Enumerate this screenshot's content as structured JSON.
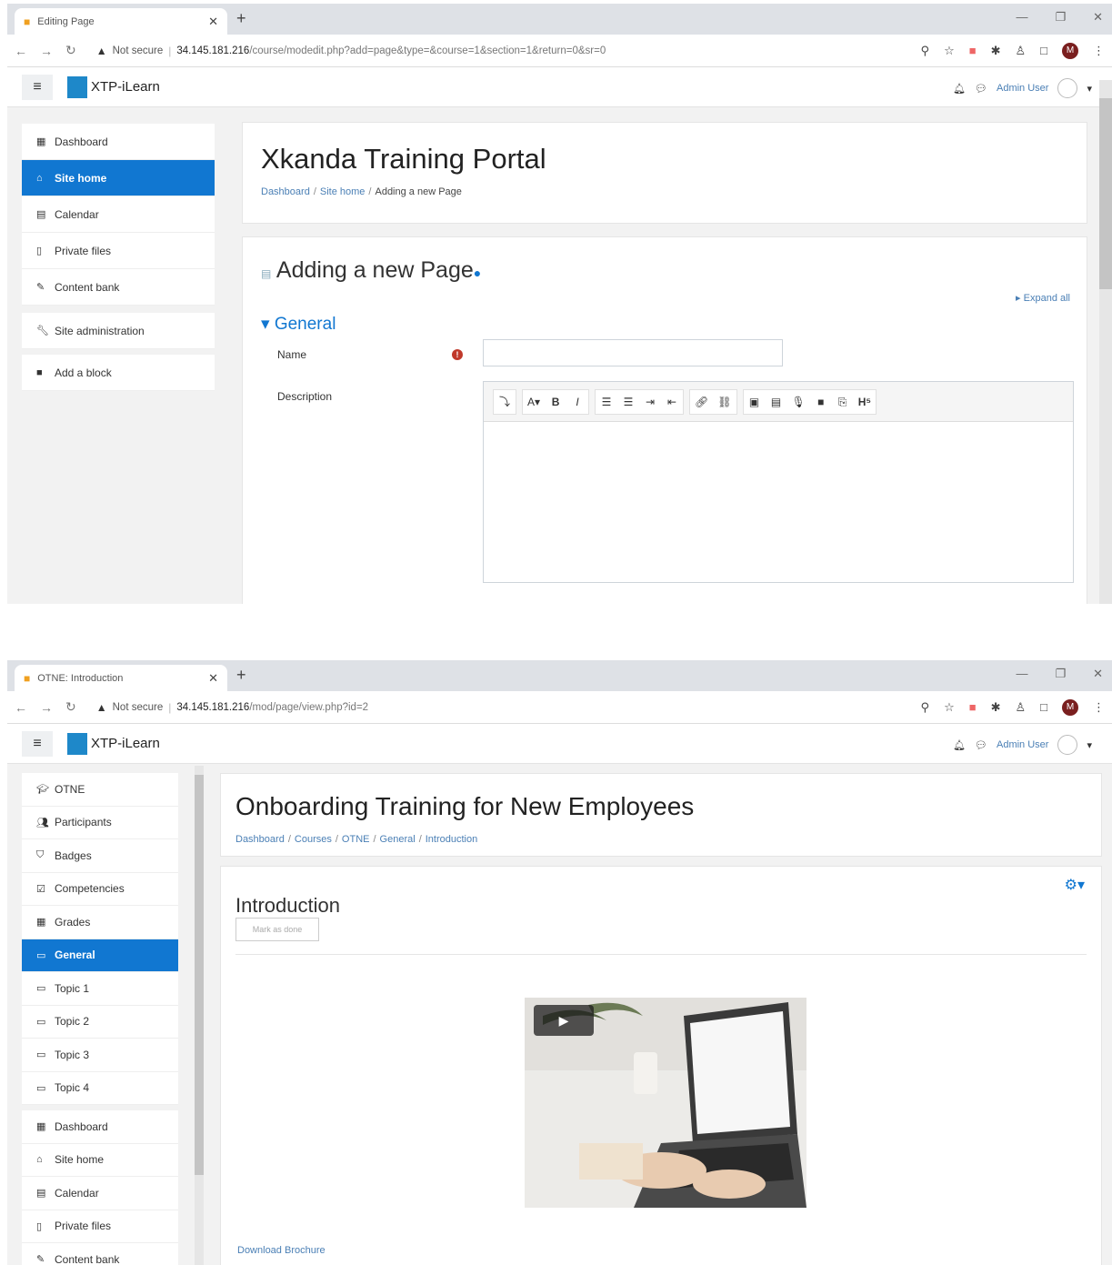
{
  "shot1": {
    "tab_title": "Editing Page",
    "url_host": "34.145.181.216",
    "url_path": "/course/modedit.php?add=page&type=&course=1&section=1&return=0&sr=0",
    "not_secure": "Not secure",
    "site_name": "XTP-iLearn",
    "user_name": "Admin User",
    "nav": [
      {
        "label": "Dashboard",
        "icon": "dashboard-icon"
      },
      {
        "label": "Site home",
        "icon": "home-icon",
        "active": true
      },
      {
        "label": "Calendar",
        "icon": "calendar-icon"
      },
      {
        "label": "Private files",
        "icon": "file-icon"
      },
      {
        "label": "Content bank",
        "icon": "brush-icon"
      }
    ],
    "nav2": [
      {
        "label": "Site administration",
        "icon": "wrench-icon"
      }
    ],
    "nav3": [
      {
        "label": "Add a block",
        "icon": "block-icon"
      }
    ],
    "page_heading": "Xkanda Training Portal",
    "breadcrumb": {
      "a": "Dashboard",
      "b": "Site home",
      "c": "Adding a new Page"
    },
    "form_title": "Adding a new Page",
    "expand_all": "Expand all",
    "section": "General",
    "name_label": "Name",
    "desc_label": "Description"
  },
  "shot2": {
    "tab_title": "OTNE: Introduction",
    "url_host": "34.145.181.216",
    "url_path": "/mod/page/view.php?id=2",
    "not_secure": "Not secure",
    "site_name": "XTP-iLearn",
    "user_name": "Admin User",
    "course_nav": [
      {
        "label": "OTNE",
        "icon": "graduation-cap-icon"
      },
      {
        "label": "Participants",
        "icon": "users-icon"
      },
      {
        "label": "Badges",
        "icon": "shield-icon"
      },
      {
        "label": "Competencies",
        "icon": "check-square-icon"
      },
      {
        "label": "Grades",
        "icon": "table-icon"
      },
      {
        "label": "General",
        "icon": "folder-icon",
        "active": true
      },
      {
        "label": "Topic 1",
        "icon": "folder-icon"
      },
      {
        "label": "Topic 2",
        "icon": "folder-icon"
      },
      {
        "label": "Topic 3",
        "icon": "folder-icon"
      },
      {
        "label": "Topic 4",
        "icon": "folder-icon"
      }
    ],
    "site_nav": [
      {
        "label": "Dashboard",
        "icon": "dashboard-icon"
      },
      {
        "label": "Site home",
        "icon": "home-icon"
      },
      {
        "label": "Calendar",
        "icon": "calendar-icon"
      },
      {
        "label": "Private files",
        "icon": "file-icon"
      },
      {
        "label": "Content bank",
        "icon": "brush-icon"
      }
    ],
    "page_heading": "Onboarding Training for New Employees",
    "breadcrumb": {
      "a": "Dashboard",
      "b": "Courses",
      "c": "OTNE",
      "d": "General",
      "e": "Introduction"
    },
    "section_title": "Introduction",
    "mark_done": "Mark as done",
    "download": "Download Brochure"
  }
}
